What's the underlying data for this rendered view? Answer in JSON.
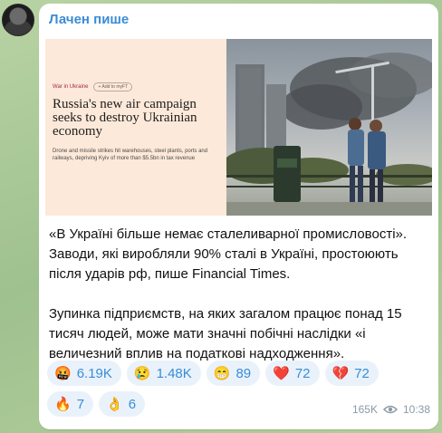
{
  "channel": {
    "name": "Лачен пише"
  },
  "media": {
    "article": {
      "tag": "War in Ukraine",
      "add_button": "+ Add to myFT",
      "headline": "Russia's new air campaign seeks to destroy Ukrainian economy",
      "deck": "Drone and missile strikes hit warehouses, steel plants, ports and railways, depriving Kyiv of more than $5.5bn in tax revenue"
    }
  },
  "message": {
    "paragraphs": [
      "«В Україні більше немає сталеливарної промисловості». Заводи, які виробляли 90% сталі в Україні, простоюють після ударів рф, пише Financial Times.",
      "Зупинка підприємств, на яких загалом працює понад 15 тисяч людей, може мати значні побічні наслідки «і величезний вплив на податкові надходження»."
    ]
  },
  "reactions": [
    {
      "emoji": "🤬",
      "count": "6.19K",
      "icon": "angry-face-icon"
    },
    {
      "emoji": "😢",
      "count": "1.48K",
      "icon": "crying-face-icon"
    },
    {
      "emoji": "😁",
      "count": "89",
      "icon": "grin-face-icon"
    },
    {
      "emoji": "❤️",
      "count": "72",
      "icon": "heart-icon"
    },
    {
      "emoji": "💔",
      "count": "72",
      "icon": "broken-heart-icon"
    },
    {
      "emoji": "🔥",
      "count": "7",
      "icon": "fire-icon"
    },
    {
      "emoji": "👌",
      "count": "6",
      "icon": "ok-hand-icon"
    }
  ],
  "footer": {
    "views": "165K",
    "time": "10:38"
  },
  "colors": {
    "accent": "#3a8cd6",
    "reaction_bg": "#e9f2fb",
    "article_bg": "#fde9d9",
    "meta": "#8a9aa7"
  }
}
